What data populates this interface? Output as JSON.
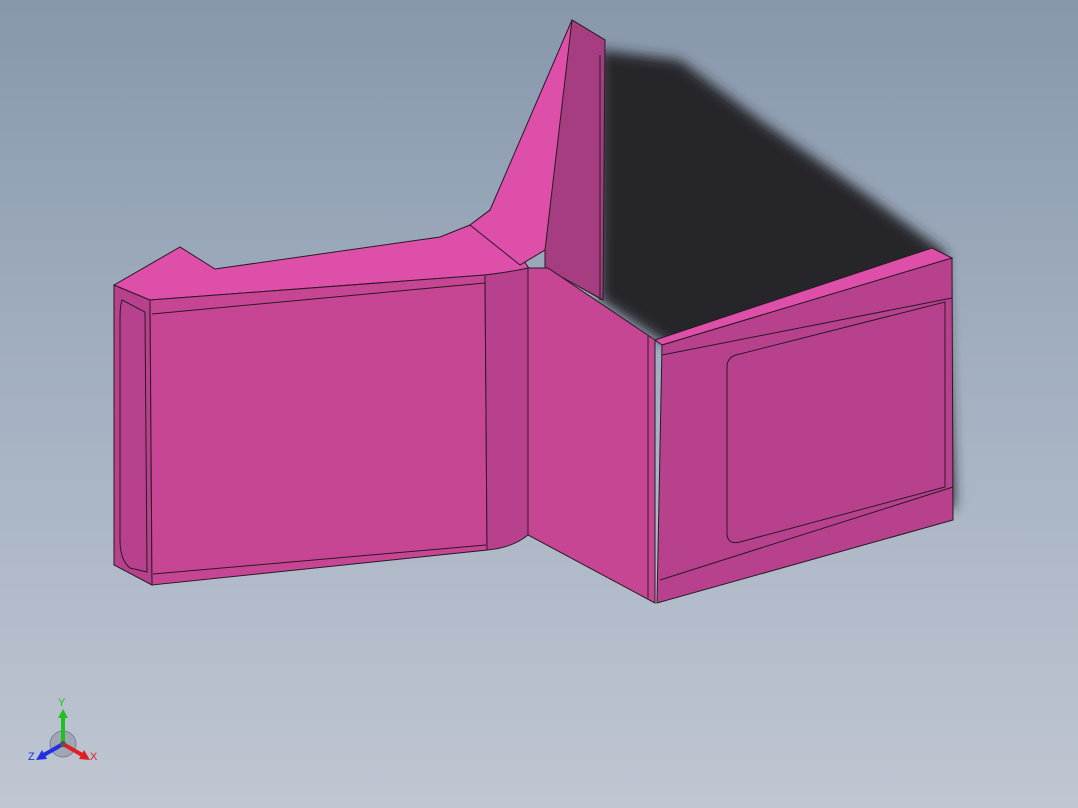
{
  "viewport": {
    "background_top": "#8797ac",
    "background_bottom": "#c0c6d2",
    "part_color": "#d04a9e",
    "shadow_color": "#25282c"
  },
  "triad": {
    "x_label": "X",
    "y_label": "Y",
    "z_label": "Z",
    "x_color": "#e02020",
    "y_color": "#20c020",
    "z_color": "#2030e0"
  }
}
